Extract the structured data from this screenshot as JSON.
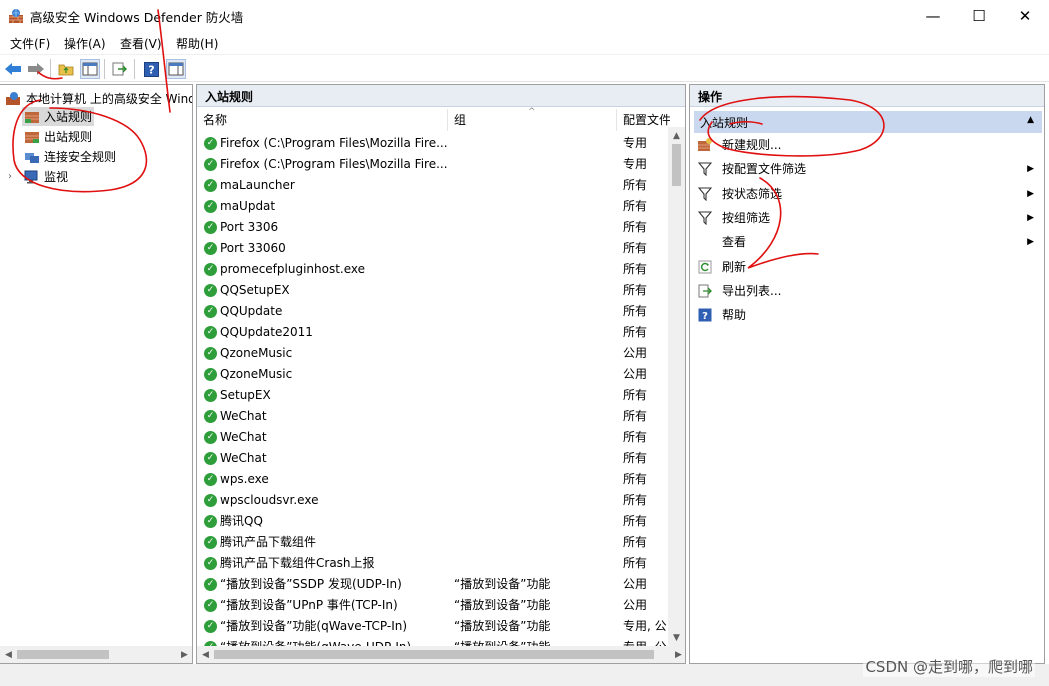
{
  "window": {
    "title": "高级安全 Windows Defender 防火墙",
    "minimize": "—",
    "maximize": "☐",
    "close": "✕"
  },
  "menu": [
    "文件(F)",
    "操作(A)",
    "查看(V)",
    "帮助(H)"
  ],
  "tree": {
    "root": "本地计算机 上的高级安全 Wind",
    "items": [
      "入站规则",
      "出站规则",
      "连接安全规则",
      "监视"
    ]
  },
  "middle": {
    "header": "入站规则",
    "columns": [
      "名称",
      "组",
      "配置文件"
    ],
    "rows": [
      {
        "name": "Firefox (C:\\Program Files\\Mozilla Fire...",
        "group": "",
        "profile": "专用"
      },
      {
        "name": "Firefox (C:\\Program Files\\Mozilla Fire...",
        "group": "",
        "profile": "专用"
      },
      {
        "name": "maLauncher",
        "group": "",
        "profile": "所有"
      },
      {
        "name": "maUpdat",
        "group": "",
        "profile": "所有"
      },
      {
        "name": "Port 3306",
        "group": "",
        "profile": "所有"
      },
      {
        "name": "Port 33060",
        "group": "",
        "profile": "所有"
      },
      {
        "name": "promecefpluginhost.exe",
        "group": "",
        "profile": "所有"
      },
      {
        "name": "QQSetupEX",
        "group": "",
        "profile": "所有"
      },
      {
        "name": "QQUpdate",
        "group": "",
        "profile": "所有"
      },
      {
        "name": "QQUpdate2011",
        "group": "",
        "profile": "所有"
      },
      {
        "name": "QzoneMusic",
        "group": "",
        "profile": "公用"
      },
      {
        "name": "QzoneMusic",
        "group": "",
        "profile": "公用"
      },
      {
        "name": "SetupEX",
        "group": "",
        "profile": "所有"
      },
      {
        "name": "WeChat",
        "group": "",
        "profile": "所有"
      },
      {
        "name": "WeChat",
        "group": "",
        "profile": "所有"
      },
      {
        "name": "WeChat",
        "group": "",
        "profile": "所有"
      },
      {
        "name": "wps.exe",
        "group": "",
        "profile": "所有"
      },
      {
        "name": "wpscloudsvr.exe",
        "group": "",
        "profile": "所有"
      },
      {
        "name": "腾讯QQ",
        "group": "",
        "profile": "所有"
      },
      {
        "name": "腾讯产品下载组件",
        "group": "",
        "profile": "所有"
      },
      {
        "name": "腾讯产品下载组件Crash上报",
        "group": "",
        "profile": "所有"
      },
      {
        "name": "“播放到设备”SSDP 发现(UDP-In)",
        "group": "“播放到设备”功能",
        "profile": "公用"
      },
      {
        "name": "“播放到设备”UPnP 事件(TCP-In)",
        "group": "“播放到设备”功能",
        "profile": "公用"
      },
      {
        "name": "“播放到设备”功能(qWave-TCP-In)",
        "group": "“播放到设备”功能",
        "profile": "专用, 公"
      },
      {
        "name": "“播放到设备”功能(qWave-UDP-In)",
        "group": "“播放到设备”功能",
        "profile": "专用, 公"
      }
    ]
  },
  "actions": {
    "header": "操作",
    "section": "入站规则",
    "items": [
      {
        "label": "新建规则...",
        "icon": "new-rule-icon",
        "submenu": false
      },
      {
        "label": "按配置文件筛选",
        "icon": "filter-icon",
        "submenu": true
      },
      {
        "label": "按状态筛选",
        "icon": "filter-icon",
        "submenu": true
      },
      {
        "label": "按组筛选",
        "icon": "filter-icon",
        "submenu": true
      },
      {
        "label": "查看",
        "icon": "",
        "submenu": true
      },
      {
        "label": "刷新",
        "icon": "refresh-icon",
        "submenu": false
      },
      {
        "label": "导出列表...",
        "icon": "export-icon",
        "submenu": false
      },
      {
        "label": "帮助",
        "icon": "help-icon",
        "submenu": false
      }
    ]
  },
  "watermark": "CSDN @走到哪，爬到哪",
  "colors": {
    "accent_selected": "#c9d8ee",
    "allow_green": "#2e9e3a",
    "annotation_red": "#e01010"
  }
}
